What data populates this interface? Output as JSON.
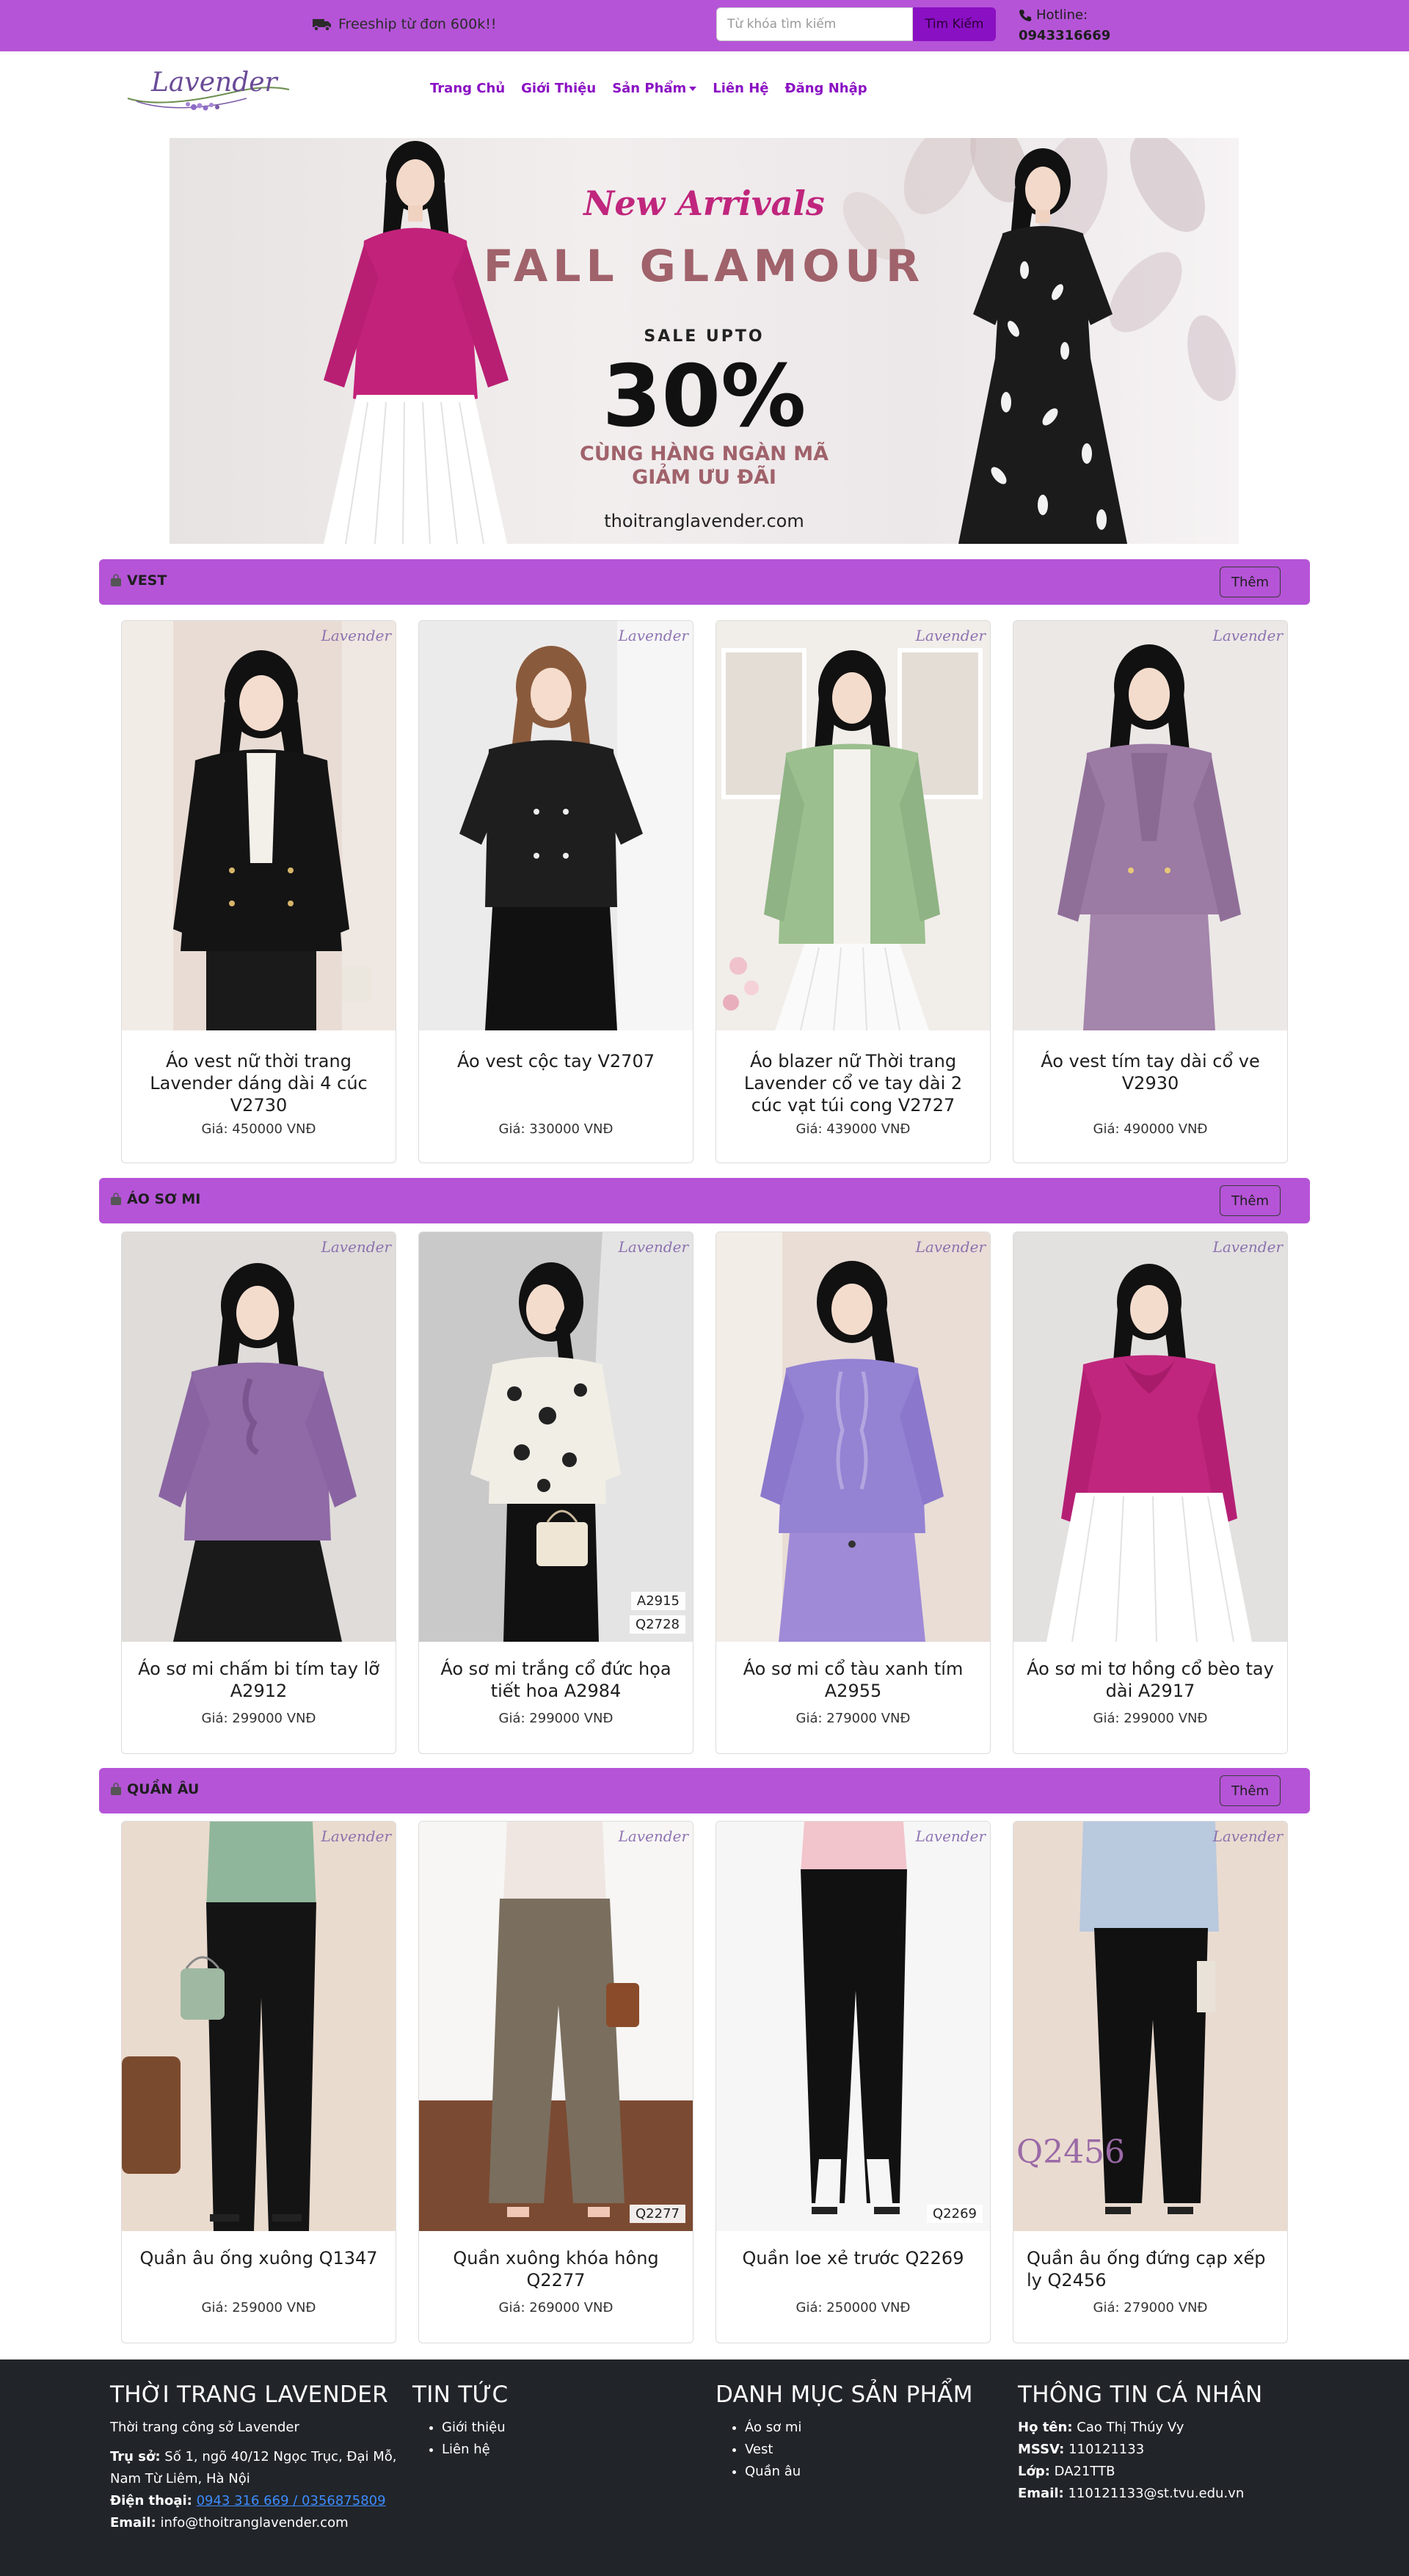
{
  "topbar": {
    "shipping_text": "Freeship từ đơn 600k!!",
    "search_placeholder": "Từ khóa tìm kiếm",
    "search_button": "Tìm Kiếm",
    "hotline_label": "Hotline:",
    "hotline_number": "0943316669",
    "colors": {
      "bar": "#b554d7",
      "button": "#8a10c3"
    }
  },
  "navbar": {
    "logo_text": "Lavender",
    "items": [
      {
        "label": "Trang Chủ"
      },
      {
        "label": "Giới Thiệu"
      },
      {
        "label": "Sản Phẩm"
      },
      {
        "label": "Liên Hệ"
      },
      {
        "label": "Đăng Nhập"
      }
    ]
  },
  "banner": {
    "line1": "New Arrivals",
    "line2": "FALL GLAMOUR",
    "line3": "SALE UPTO",
    "line4": "30%",
    "line5": "CÙNG HÀNG NGÀN MÃ",
    "line6": "GIẢM ƯU ĐÃI",
    "site": "thoitranglavender.com"
  },
  "sections": [
    {
      "title": "VEST",
      "more_label": "Thêm",
      "products": [
        {
          "name": "Áo vest nữ thời trang Lavender dáng dài 4 cúc V2730",
          "price": "Giá: 450000 VNĐ"
        },
        {
          "name": "Áo vest cộc tay V2707",
          "price": "Giá: 330000 VNĐ"
        },
        {
          "name": "Áo blazer nữ Thời trang Lavender cổ ve tay dài 2 cúc vạt túi cong V2727",
          "price": "Giá: 439000 VNĐ"
        },
        {
          "name": "Áo vest tím tay dài cổ ve V2930",
          "price": "Giá: 490000 VNĐ"
        }
      ]
    },
    {
      "title": "ÁO SƠ MI",
      "more_label": "Thêm",
      "products": [
        {
          "name": "Áo sơ mi chấm bi tím tay lỡ A2912",
          "price": "Giá: 299000 VNĐ"
        },
        {
          "name": "Áo sơ mi trắng cổ đức họa tiết hoa A2984",
          "price": "Giá: 299000 VNĐ"
        },
        {
          "name": "Áo sơ mi cổ tàu xanh tím A2955",
          "price": "Giá: 279000 VNĐ"
        },
        {
          "name": "Áo sơ mi tơ hồng cổ bèo tay dài A2917",
          "price": "Giá: 299000 VNĐ"
        }
      ]
    },
    {
      "title": "QUẦN ÂU",
      "more_label": "Thêm",
      "products": [
        {
          "name": "Quần âu ống xuông Q1347",
          "price": "Giá: 259000 VNĐ"
        },
        {
          "name": "Quần xuông khóa hông Q2277",
          "price": "Giá: 269000 VNĐ"
        },
        {
          "name": "Quần loe xẻ trước Q2269",
          "price": "Giá: 250000 VNĐ"
        },
        {
          "name": "Quần âu ống đứng cạp xếp ly Q2456",
          "price": "Giá: 279000 VNĐ"
        }
      ]
    }
  ],
  "image_tags": {
    "shirt_2_top": "A2915",
    "shirt_2_bottom": "Q2728",
    "pants_2": "Q2277",
    "pants_3": "Q2269",
    "pants_4": "Q2456"
  },
  "footer": {
    "col1": {
      "title": "THỜI TRANG LAVENDER",
      "tagline": "Thời trang công sở Lavender",
      "address_label": "Trụ sở:",
      "address": "Số 1, ngõ 40/12 Ngọc Trục, Đại Mỗ, Nam Từ Liêm, Hà Nội",
      "phone_label": "Điện thoại:",
      "phone": "0943 316 669 / 0356875809",
      "email_label": "Email:",
      "email": "info@thoitranglavender.com"
    },
    "col2": {
      "title": "TIN TỨC",
      "items": [
        "Giới thiệu",
        "Liên hệ"
      ]
    },
    "col3": {
      "title": "DANH MỤC SẢN PHẨM",
      "items": [
        "Áo sơ mi",
        "Vest",
        "Quần âu"
      ]
    },
    "col4": {
      "title": "THÔNG TIN CÁ NHÂN",
      "name_label": "Họ tên:",
      "name": "Cao Thị Thúy Vy",
      "mssv_label": "MSSV:",
      "mssv": "110121133",
      "class_label": "Lớp:",
      "class": "DA21TTB",
      "email_label": "Email:",
      "email": "110121133@st.tvu.edu.vn"
    }
  }
}
